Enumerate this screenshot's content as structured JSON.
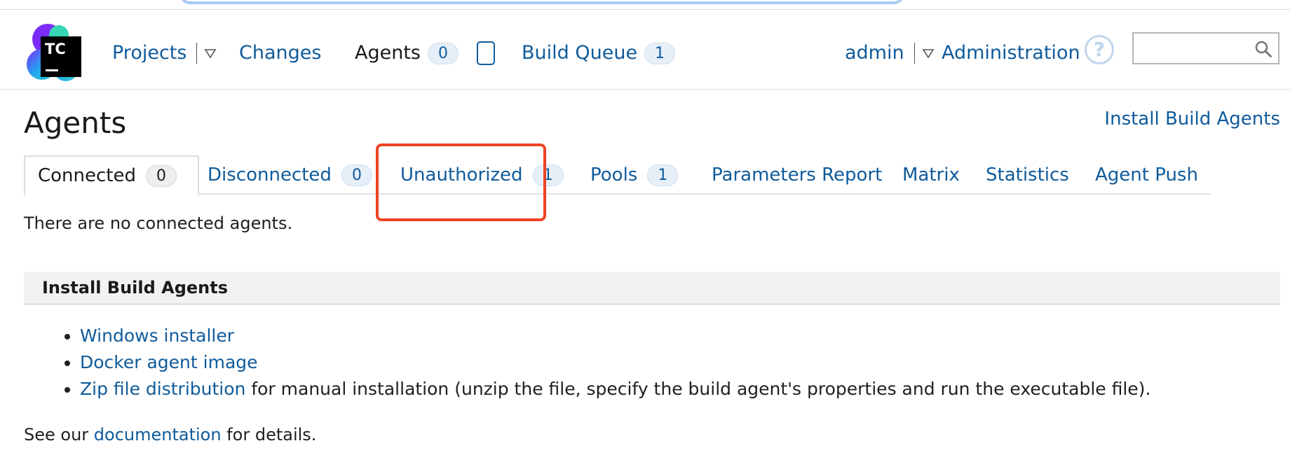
{
  "header": {
    "nav": {
      "projects": "Projects",
      "changes": "Changes",
      "agents": "Agents",
      "agents_count": "0",
      "build_queue": "Build Queue",
      "build_queue_count": "1"
    },
    "user": "admin",
    "administration": "Administration",
    "help_symbol": "?",
    "search": {
      "value": "",
      "placeholder": ""
    }
  },
  "page": {
    "title": "Agents",
    "install_link": "Install Build Agents"
  },
  "tabs": [
    {
      "label": "Connected",
      "count": "0"
    },
    {
      "label": "Disconnected",
      "count": "0"
    },
    {
      "label": "Unauthorized",
      "count": "1"
    },
    {
      "label": "Pools",
      "count": "1"
    },
    {
      "label": "Parameters Report"
    },
    {
      "label": "Matrix"
    },
    {
      "label": "Statistics"
    },
    {
      "label": "Agent Push"
    }
  ],
  "content": {
    "no_agents_text": "There are no connected agents.",
    "install_section": {
      "title": "Install Build Agents",
      "items": [
        {
          "link": "Windows installer",
          "text": ""
        },
        {
          "link": "Docker agent image",
          "text": ""
        },
        {
          "link": "Zip file distribution",
          "text": " for manual installation (unzip the file, specify the build agent's properties and run the executable file)."
        }
      ]
    },
    "footer": {
      "prefix": "See our ",
      "link": "documentation",
      "suffix": " for details."
    }
  },
  "colors": {
    "link": "#0f5b9b",
    "highlight": "#ee4424",
    "badge_bg": "#e6eff8"
  },
  "icons": {
    "logo": "teamcity-logo",
    "dropdown": "triangle-down-icon",
    "agents_box": "rounded-square-icon",
    "help": "help-circle-icon",
    "search": "search-icon"
  }
}
